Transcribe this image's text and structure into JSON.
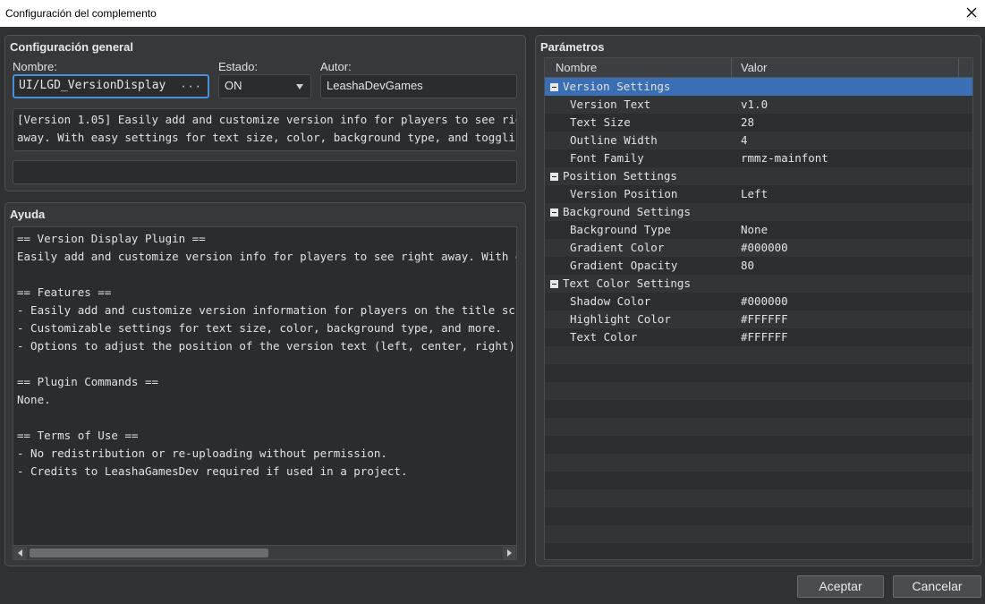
{
  "window": {
    "title": "Configuración del complemento"
  },
  "general": {
    "title": "Configuración general",
    "name_label": "Nombre:",
    "name_value": "UI/LGD_VersionDisplay",
    "name_button": "···",
    "state_label": "Estado:",
    "state_value": "ON",
    "author_label": "Autor:",
    "author_value": "LeashaDevGames",
    "description_lines": [
      "[Version 1.05] Easily add and customize version info for players to see right",
      "away. With easy settings for text size, color, background type, and toggling"
    ],
    "extra_value": ""
  },
  "help": {
    "title": "Ayuda",
    "lines": [
      "== Version Display Plugin ==",
      "Easily add and customize version info for players to see right away. With easy",
      "",
      "== Features ==",
      "- Easily add and customize version information for players on the title screen.",
      "- Customizable settings for text size, color, background type, and more.",
      "- Options to adjust the position of the version text (left, center, right).",
      "",
      "== Plugin Commands ==",
      "None.",
      "",
      "== Terms of Use ==",
      "- No redistribution or re-uploading without permission.",
      "- Credits to LeashaGamesDev required if used in a project."
    ]
  },
  "params": {
    "title": "Parámetros",
    "col_name": "Nombre",
    "col_value": "Valor",
    "rows": [
      {
        "name": "Version Settings",
        "value": "",
        "group": true,
        "selected": true
      },
      {
        "name": "Version Text",
        "value": "v1.0"
      },
      {
        "name": "Text Size",
        "value": "28"
      },
      {
        "name": "Outline Width",
        "value": "4"
      },
      {
        "name": "Font Family",
        "value": "rmmz-mainfont"
      },
      {
        "name": "Position Settings",
        "value": "",
        "group": true
      },
      {
        "name": "Version Position",
        "value": "Left"
      },
      {
        "name": "Background Settings",
        "value": "",
        "group": true
      },
      {
        "name": "Background Type",
        "value": "None"
      },
      {
        "name": "Gradient Color",
        "value": "#000000"
      },
      {
        "name": "Gradient Opacity",
        "value": "80"
      },
      {
        "name": "Text Color Settings",
        "value": "",
        "group": true
      },
      {
        "name": "Shadow Color",
        "value": "#000000"
      },
      {
        "name": "Highlight Color",
        "value": "#FFFFFF"
      },
      {
        "name": "Text Color",
        "value": "#FFFFFF"
      }
    ]
  },
  "buttons": {
    "ok": "Aceptar",
    "cancel": "Cancelar"
  },
  "colors": {
    "background": "#2f3133",
    "panel": "#36383a",
    "selection": "#3a6fb5",
    "focus": "#4a90d9"
  }
}
